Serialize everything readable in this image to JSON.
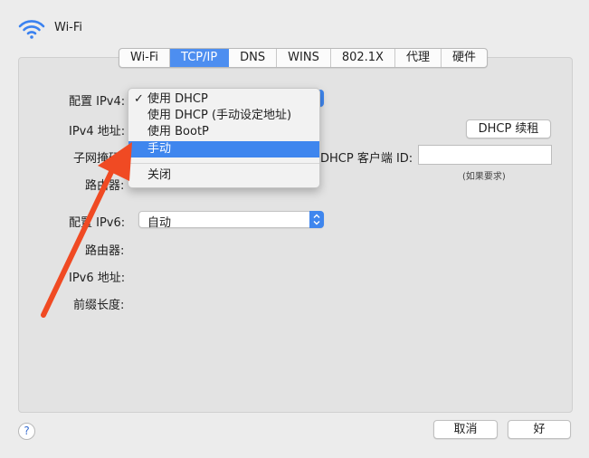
{
  "header": {
    "title": "Wi-Fi",
    "icon": "wifi-icon"
  },
  "tabs": [
    {
      "label": "Wi-Fi",
      "active": false
    },
    {
      "label": "TCP/IP",
      "active": true
    },
    {
      "label": "DNS",
      "active": false
    },
    {
      "label": "WINS",
      "active": false
    },
    {
      "label": "802.1X",
      "active": false
    },
    {
      "label": "代理",
      "active": false
    },
    {
      "label": "硬件",
      "active": false
    }
  ],
  "ipv4": {
    "config_label": "配置 IPv4:",
    "address_label": "IPv4 地址:",
    "subnet_label": "子网掩码",
    "router_label": "路由器:",
    "dhcp_renew": "DHCP 续租",
    "client_id_label": "DHCP 客户端 ID:",
    "client_id_hint": "(如果要求)",
    "client_id_value": ""
  },
  "ipv4_menu": {
    "items": [
      {
        "label": "使用 DHCP",
        "checked": true
      },
      {
        "label": "使用 DHCP (手动设定地址)",
        "checked": false
      },
      {
        "label": "使用 BootP",
        "checked": false
      },
      {
        "label": "手动",
        "checked": false,
        "highlighted": true
      },
      {
        "label": "关闭",
        "checked": false
      }
    ],
    "check_glyph": "✓"
  },
  "ipv6": {
    "config_label": "配置 IPv6:",
    "config_value": "自动",
    "router_label": "路由器:",
    "address_label": "IPv6 地址:",
    "prefix_label": "前缀长度:"
  },
  "footer": {
    "help_glyph": "?",
    "cancel_label": "取消",
    "ok_label": "好"
  },
  "colors": {
    "accent": "#3f86ee",
    "annotation_arrow": "#f04a23"
  }
}
